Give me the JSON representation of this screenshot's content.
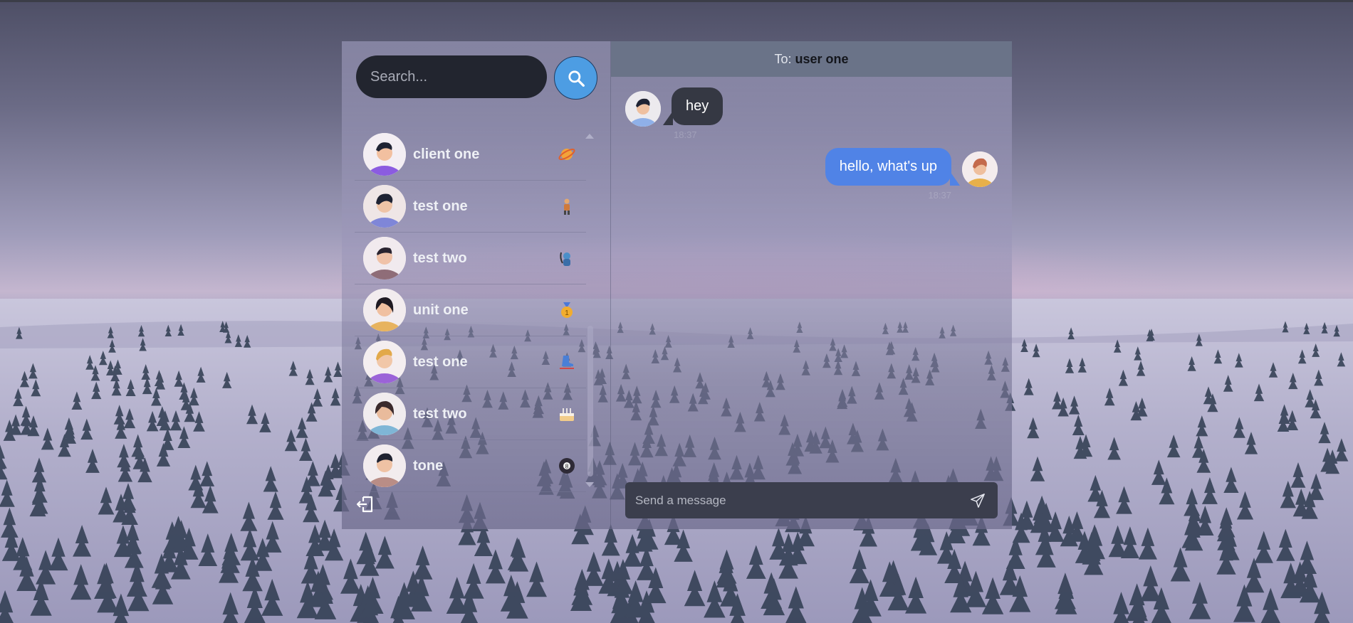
{
  "search": {
    "placeholder": "Search..."
  },
  "contacts": [
    {
      "name": "client one",
      "emoji": "planet-icon"
    },
    {
      "name": "test one",
      "emoji": "person-icon"
    },
    {
      "name": "test two",
      "emoji": "diver-icon"
    },
    {
      "name": "unit one",
      "emoji": "medal-icon"
    },
    {
      "name": "test one",
      "emoji": "skate-icon"
    },
    {
      "name": "test two",
      "emoji": "cake-icon"
    },
    {
      "name": "tone",
      "emoji": "eight-ball-icon"
    }
  ],
  "chat": {
    "to_label": "To:",
    "to_name": "user one",
    "messages": [
      {
        "direction": "in",
        "text": "hey",
        "time": "18:37"
      },
      {
        "direction": "out",
        "text": "hello, what's up",
        "time": "18:37"
      }
    ],
    "composer_placeholder": "Send a message"
  },
  "colors": {
    "accent": "#4d9de3",
    "outgoing_bubble": "#5083e6",
    "incoming_bubble": "#353843",
    "header": "#6a7388"
  }
}
